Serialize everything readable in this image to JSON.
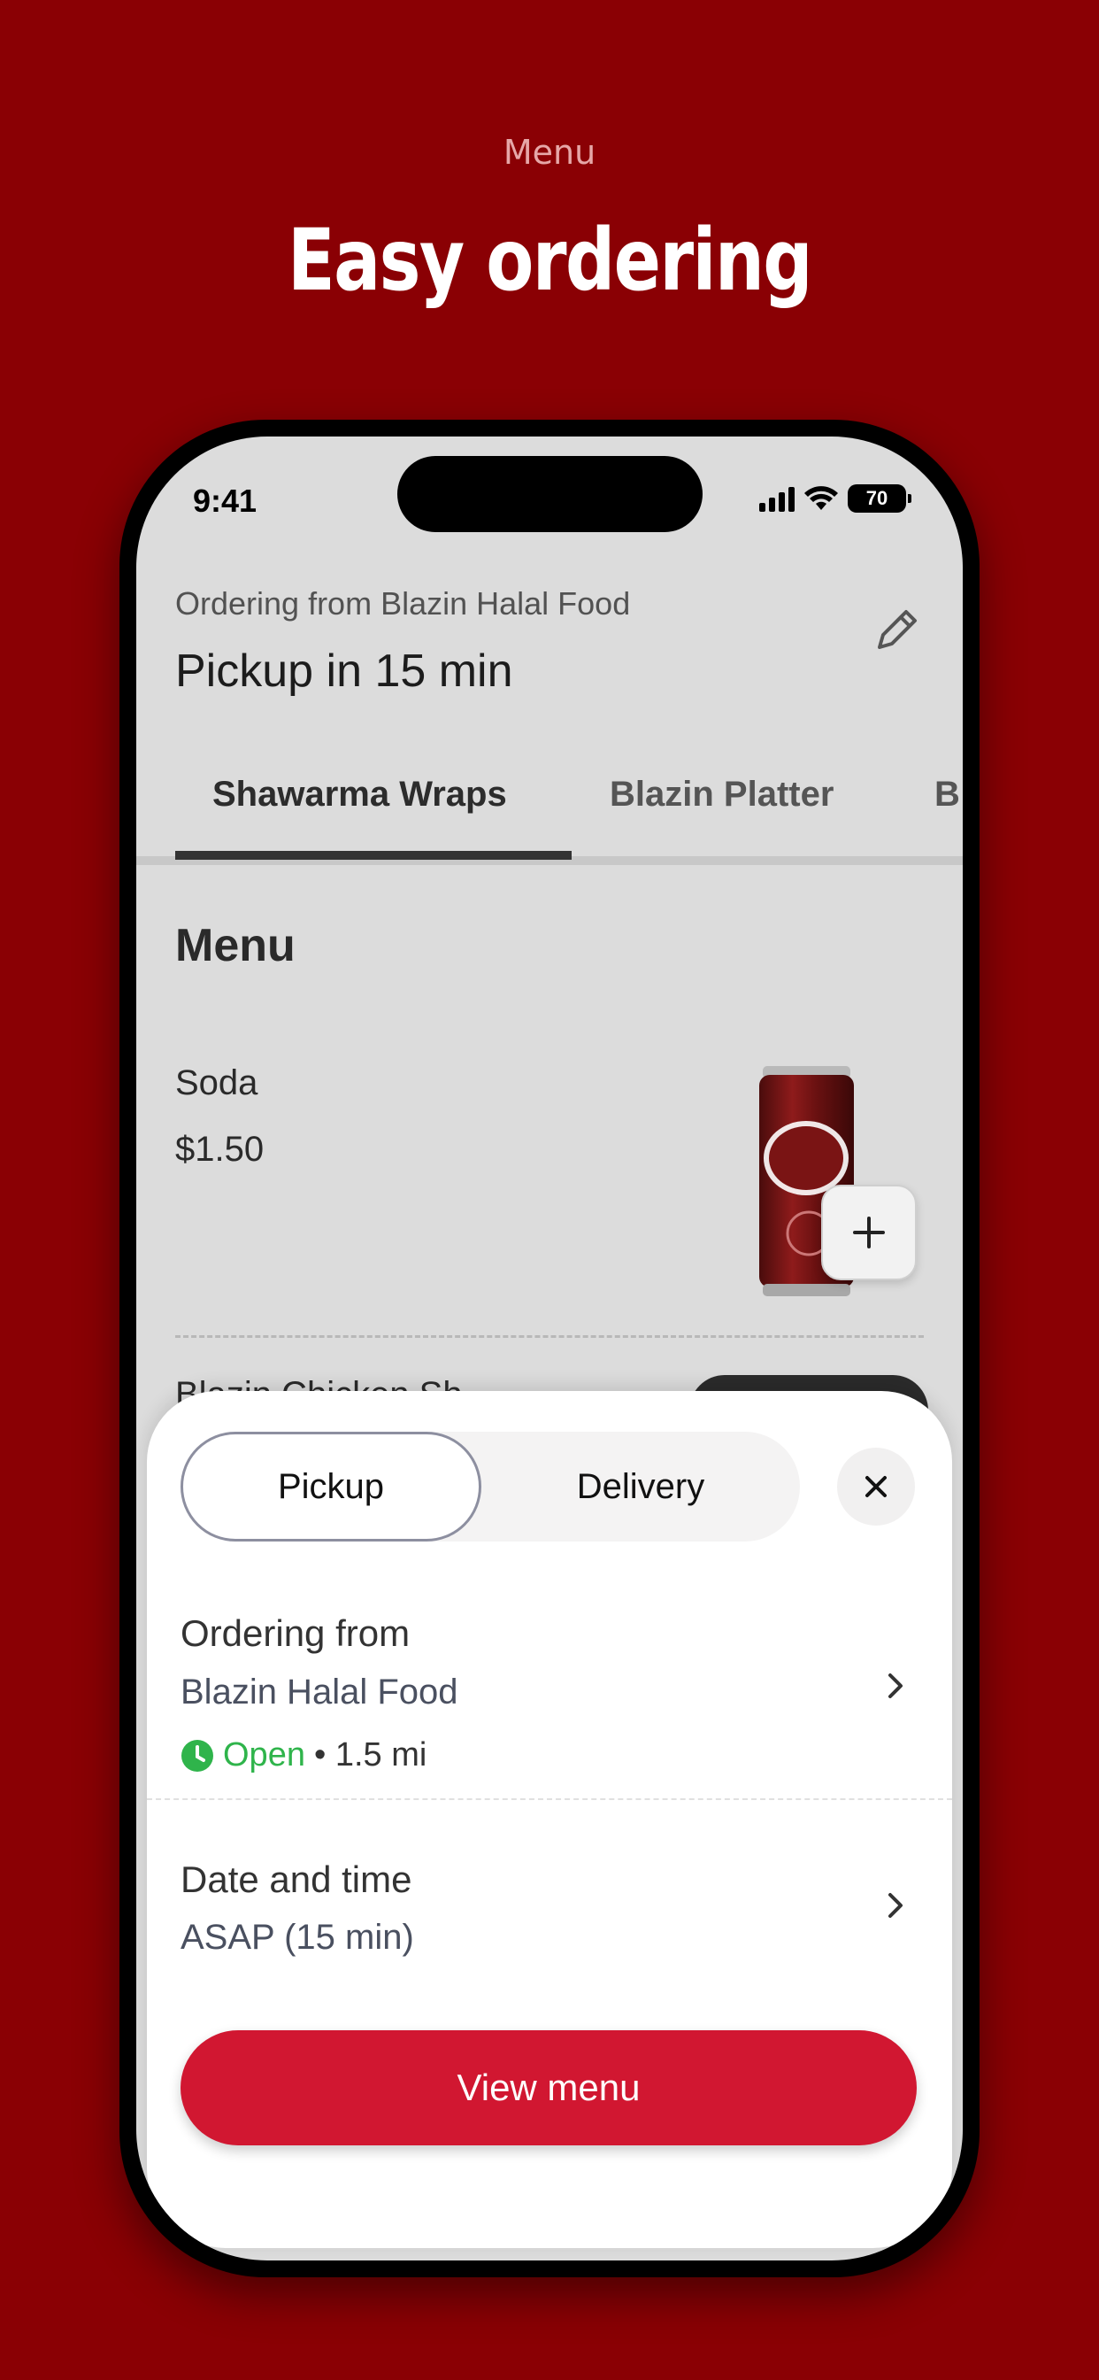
{
  "hero": {
    "eyebrow": "Menu",
    "title": "Easy ordering"
  },
  "status_bar": {
    "time": "9:41",
    "battery": "70"
  },
  "header": {
    "ordering_from": "Ordering from Blazin Halal Food",
    "pickup_time": "Pickup in 15 min"
  },
  "tabs": [
    {
      "label": "Shawarma Wraps",
      "active": true
    },
    {
      "label": "Blazin Platter",
      "active": false
    },
    {
      "label": "B",
      "active": false
    }
  ],
  "menu": {
    "heading": "Menu",
    "items": [
      {
        "name": "Soda",
        "price": "$1.50",
        "image": "dr-pepper-can"
      }
    ],
    "peek_item": "Blazin Chicken Sh"
  },
  "sheet": {
    "mode_options": [
      "Pickup",
      "Delivery"
    ],
    "selected_mode": "Pickup",
    "ordering_from_label": "Ordering from",
    "restaurant_name": "Blazin Halal Food",
    "open_status": "Open",
    "distance": "• 1.5 mi",
    "date_time_label": "Date and time",
    "date_time_value": "ASAP (15 min)",
    "cta_label": "View menu"
  },
  "colors": {
    "background": "#8a0004",
    "cta": "#d11731",
    "open_green": "#2fb44b"
  }
}
